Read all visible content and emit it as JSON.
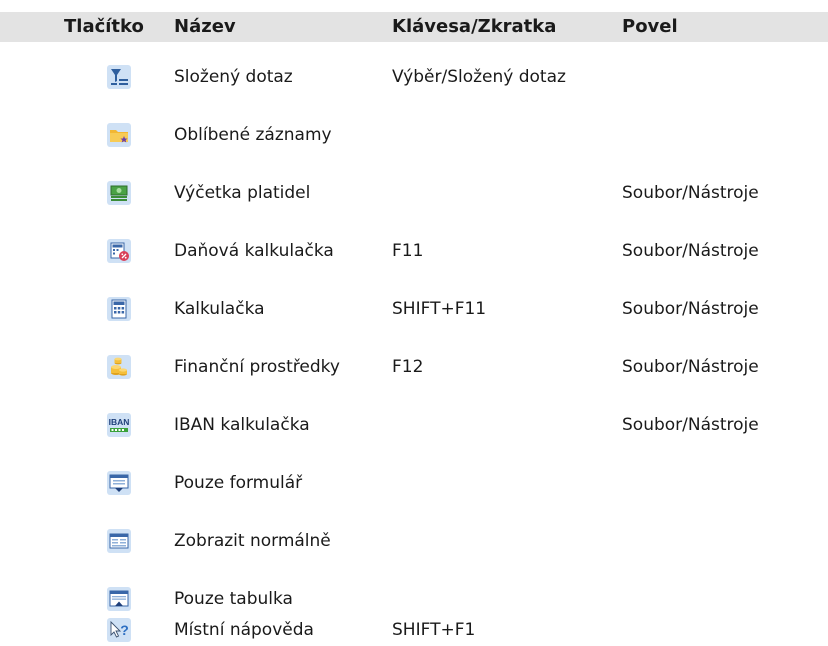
{
  "header": {
    "button": "Tlačítko",
    "name": "Název",
    "key": "Klávesa/Zkratka",
    "command": "Povel"
  },
  "rows": [
    {
      "icon": "compound-query-icon",
      "name": "Složený dotaz",
      "key": "Výběr/Složený dotaz",
      "command": ""
    },
    {
      "icon": "favorite-records-icon",
      "name": "Oblíbené záznamy",
      "key": "",
      "command": ""
    },
    {
      "icon": "cash-count-icon",
      "name": "Výčetka platidel",
      "key": "",
      "command": "Soubor/Nástroje"
    },
    {
      "icon": "tax-calculator-icon",
      "name": "Daňová kalkulačka",
      "key": "F11",
      "command": "Soubor/Nástroje"
    },
    {
      "icon": "calculator-icon",
      "name": "Kalkulačka",
      "key": "SHIFT+F11",
      "command": "Soubor/Nástroje"
    },
    {
      "icon": "funds-icon",
      "name": "Finanční prostředky",
      "key": "F12",
      "command": "Soubor/Nástroje"
    },
    {
      "icon": "iban-calculator-icon",
      "name": "IBAN kalkulačka",
      "key": "",
      "command": "Soubor/Nástroje"
    },
    {
      "icon": "form-only-icon",
      "name": "Pouze formulář",
      "key": "",
      "command": ""
    },
    {
      "icon": "normal-view-icon",
      "name": "Zobrazit normálně",
      "key": "",
      "command": ""
    },
    {
      "icon": "table-only-icon",
      "name": "Pouze tabulka",
      "key": "",
      "command": ""
    },
    {
      "icon": "context-help-icon",
      "name": "Místní nápověda",
      "key": "SHIFT+F1",
      "command": ""
    }
  ],
  "icon_text": {
    "iban": "IBAN",
    "help": "?"
  }
}
